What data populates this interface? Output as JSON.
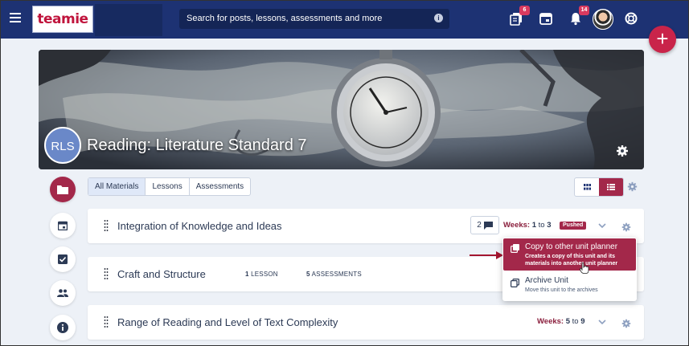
{
  "topbar": {
    "logo": "teamie",
    "search_placeholder": "Search for posts, lessons, assessments and more",
    "notifications": [
      {
        "icon": "posts-icon",
        "badge": "6"
      },
      {
        "icon": "calendar-icon",
        "badge": ""
      },
      {
        "icon": "bell-icon",
        "badge": "14"
      }
    ]
  },
  "course": {
    "initials": "RLS",
    "title": "Reading: Literature Standard 7"
  },
  "filters": {
    "tabs": [
      "All Materials",
      "Lessons",
      "Assessments"
    ],
    "active": "All Materials"
  },
  "units": [
    {
      "title": "Integration of Knowledge and Ideas",
      "comments": "2",
      "weeks_label": "Weeks:",
      "week_start": "1",
      "week_to": "to",
      "week_end": "3",
      "status": "Pushed"
    },
    {
      "title": "Craft and Structure",
      "lesson_count": "1",
      "lesson_label": "LESSON",
      "assessment_count": "5",
      "assessment_label": "ASSESSMENTS"
    },
    {
      "title": "Range of Reading and Level of Text Complexity",
      "weeks_label": "Weeks:",
      "week_start": "5",
      "week_to": "to",
      "week_end": "9"
    }
  ],
  "unit_menu": {
    "copy_title": "Copy to other unit planner",
    "copy_desc": "Creates a copy of this unit and its materials into another unit planner",
    "archive_title": "Archive Unit",
    "archive_desc": "Move this unit to the archives"
  },
  "colors": {
    "nav": "#1d3273",
    "accent": "#a3284a",
    "fab": "#c9244a"
  }
}
